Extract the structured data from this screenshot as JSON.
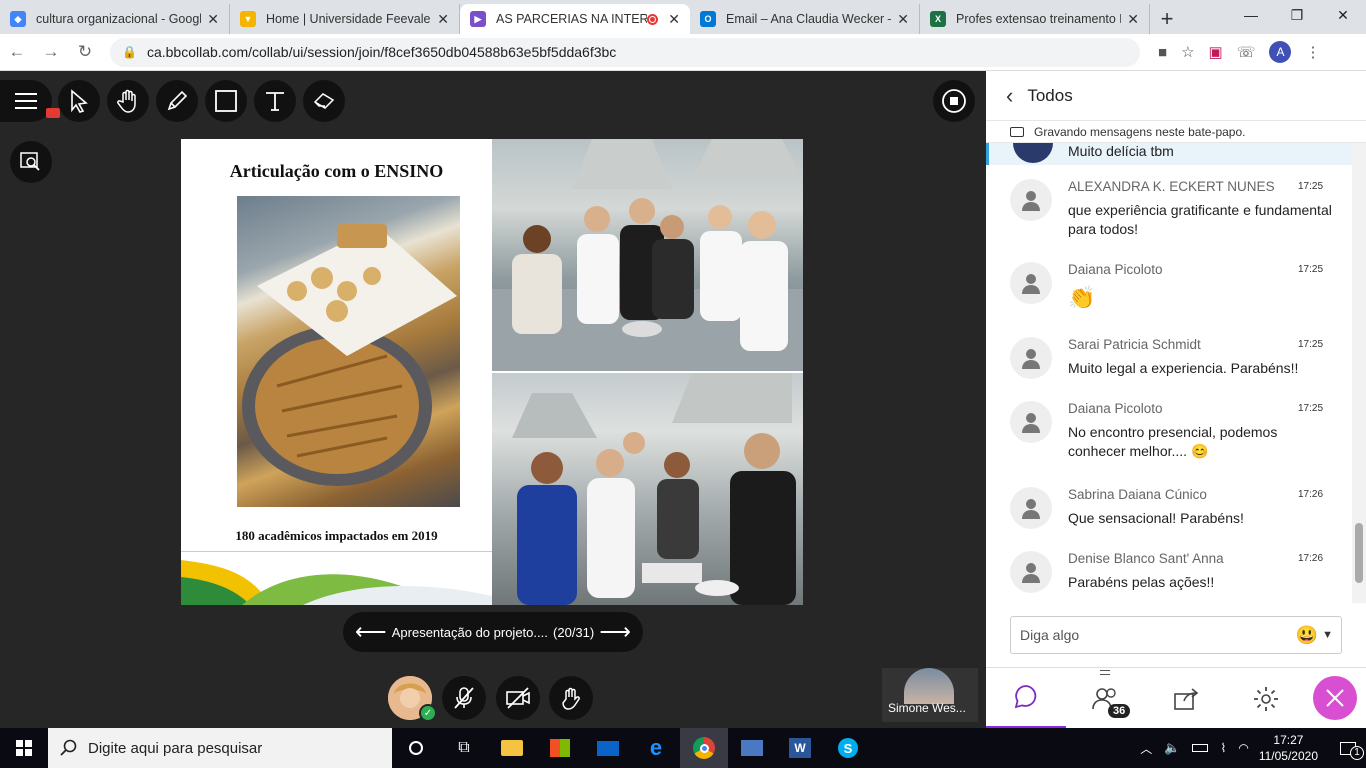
{
  "browser": {
    "tabs": [
      {
        "title": "cultura organizacional - Googl",
        "color": "#4285f4"
      },
      {
        "title": "Home | Universidade Feevale",
        "color": "#f4b400"
      },
      {
        "title": "AS PARCERIAS NA INTERLO",
        "color": "#7b4fc9",
        "active": true
      },
      {
        "title": "Email – Ana Claudia Wecker – O",
        "color": "#0078d4"
      },
      {
        "title": "Profes extensao treinamento E",
        "color": "#1e7145"
      }
    ],
    "url": "ca.bbcollab.com/collab/ui/session/join/f8cef3650db04588b63e5bf5dda6f3bc",
    "profile_initial": "A"
  },
  "slide": {
    "title": "Articulação com o ENSINO",
    "caption": "180 acadêmicos impactados em 2019"
  },
  "slide_nav": {
    "label": "Apresentação do projeto....",
    "counter": "(20/31)"
  },
  "participant": {
    "name": "Simone Wes..."
  },
  "chat": {
    "header": "Todos",
    "recording_notice": "Gravando mensagens neste bate-papo.",
    "partial_text": "Muito delícia tbm",
    "messages": [
      {
        "name": "ALEXANDRA K. ECKERT NUNES",
        "time": "17:25",
        "text": "que experiência gratificante e fundamental para todos!"
      },
      {
        "name": "Daiana Picoloto",
        "time": "17:25",
        "text": "👏"
      },
      {
        "name": "Sarai Patricia Schmidt",
        "time": "17:25",
        "text": "Muito legal a experiencia. Parabéns!!"
      },
      {
        "name": "Daiana Picoloto",
        "time": "17:25",
        "text": "No encontro presencial, podemos conhecer melhor.... 😊"
      },
      {
        "name": "Sabrina Daiana Cúnico",
        "time": "17:26",
        "text": "Que sensacional! Parabéns!"
      },
      {
        "name": "Denise Blanco Sant' Anna",
        "time": "17:26",
        "text": "Parabéns pelas ações!!"
      }
    ],
    "input_placeholder": "Diga algo",
    "attendee_count": "36"
  },
  "taskbar": {
    "search_placeholder": "Digite aqui para pesquisar",
    "time": "17:27",
    "date": "11/05/2020",
    "notification_count": "1"
  }
}
